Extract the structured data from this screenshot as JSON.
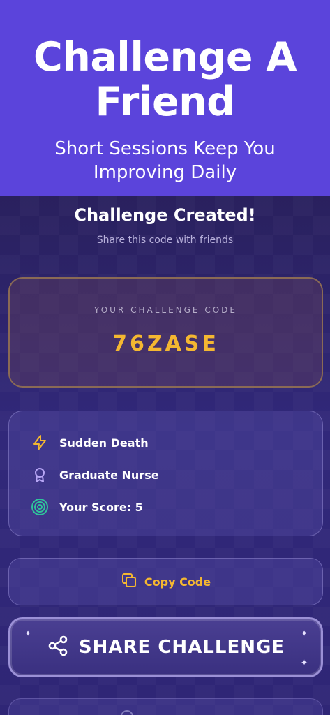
{
  "banner": {
    "title_line1": "Challenge A",
    "title_line2": "Friend",
    "subtitle_line1": "Short Sessions Keep You",
    "subtitle_line2": "Improving Daily"
  },
  "status": {
    "title": "Challenge Created!",
    "subtitle": "Share this code with friends"
  },
  "code_card": {
    "label": "YOUR CHALLENGE CODE",
    "code": "76ZASE"
  },
  "details": [
    {
      "icon": "lightning-icon",
      "text": "Sudden Death"
    },
    {
      "icon": "award-ribbon-icon",
      "text": "Graduate Nurse"
    },
    {
      "icon": "target-icon",
      "text": "Your Score: 5"
    }
  ],
  "actions": {
    "copy_label": "Copy Code",
    "copy_icon": "copy-icon",
    "share_label": "SHARE CHALLENGE",
    "share_icon": "share-icon"
  },
  "colors": {
    "banner": "#5b44db",
    "accent_gold": "#f4b731",
    "background": "#2a2160"
  }
}
